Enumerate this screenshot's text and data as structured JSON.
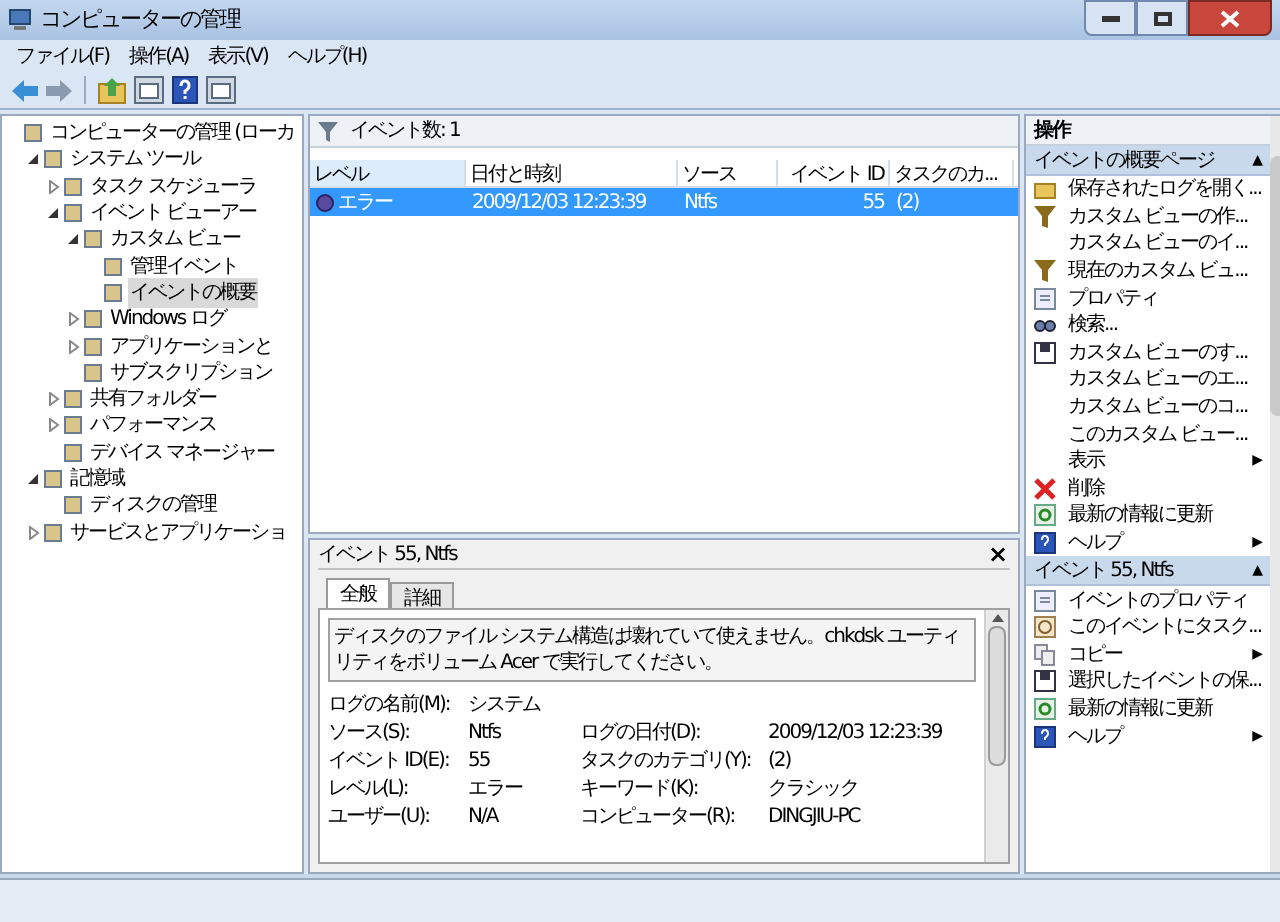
{
  "window": {
    "title": "コンピューターの管理"
  },
  "menu": [
    "ファイル(F)",
    "操作(A)",
    "表示(V)",
    "ヘルプ(H)"
  ],
  "tree": [
    {
      "label": "コンピューターの管理 (ローカ",
      "selected": false,
      "children": [
        {
          "label": "システム ツール",
          "expanded": true,
          "selected": false,
          "children": [
            {
              "label": "タスク スケジューラ",
              "expanded": false,
              "selected": false
            },
            {
              "label": "イベント ビューアー",
              "expanded": true,
              "selected": false,
              "children": [
                {
                  "label": "カスタム ビュー",
                  "expanded": true,
                  "selected": false,
                  "children": [
                    {
                      "label": "管理イベント",
                      "selected": false
                    },
                    {
                      "label": "イベントの概要",
                      "selected": true
                    }
                  ]
                },
                {
                  "label": "Windows ログ",
                  "expanded": false,
                  "selected": false
                },
                {
                  "label": "アプリケーションと",
                  "expanded": false,
                  "selected": false
                },
                {
                  "label": "サブスクリプション",
                  "selected": false
                }
              ]
            },
            {
              "label": "共有フォルダー",
              "expanded": false,
              "selected": false
            },
            {
              "label": "パフォーマンス",
              "expanded": false,
              "selected": false
            },
            {
              "label": "デバイス マネージャー",
              "selected": false
            }
          ]
        },
        {
          "label": "記憶域",
          "expanded": true,
          "selected": false,
          "children": [
            {
              "label": "ディスクの管理",
              "selected": false
            }
          ]
        },
        {
          "label": "サービスとアプリケーショ",
          "expanded": false,
          "selected": false
        }
      ]
    }
  ],
  "events": {
    "count_label": "イベント数: 1",
    "columns": [
      "レベル",
      "日付と時刻",
      "ソース",
      "イベント ID",
      "タスクのカ..."
    ],
    "rows": [
      {
        "selected": true,
        "cells": [
          "エラー",
          "2009/12/03 12:23:39",
          "Ntfs",
          "55",
          "(2)"
        ]
      }
    ]
  },
  "details": {
    "title": "イベント 55, Ntfs",
    "close": "×",
    "tabs": [
      {
        "label": "全般",
        "selected": true
      },
      {
        "label": "詳細",
        "selected": false
      }
    ],
    "message": "ディスクのファイル システム構造は壊れていて使えません。chkdsk ユーティリティをボリューム Acer で実行してください。",
    "fields": [
      [
        {
          "label": "ログの名前(M):",
          "value": "システム"
        }
      ],
      [
        {
          "label": "ソース(S):",
          "value": "Ntfs"
        },
        {
          "label": "ログの日付(D):",
          "value": "2009/12/03 12:23:39"
        }
      ],
      [
        {
          "label": "イベント ID(E):",
          "value": "55"
        },
        {
          "label": "タスクのカテゴリ(Y):",
          "value": "(2)"
        }
      ],
      [
        {
          "label": "レベル(L):",
          "value": "エラー"
        },
        {
          "label": "キーワード(K):",
          "value": "クラシック"
        }
      ],
      [
        {
          "label": "ユーザー(U):",
          "value": "N/A"
        },
        {
          "label": "コンピューター(R):",
          "value": "DINGJIU-PC"
        }
      ]
    ]
  },
  "actions": {
    "title": "操作",
    "sections": [
      {
        "title": "イベントの概要ページ",
        "collapse": "▲",
        "items": [
          {
            "kind": "open",
            "label": "保存されたログを開く..."
          },
          {
            "kind": "filter",
            "label": "カスタム ビューの作..."
          },
          {
            "kind": "none",
            "label": "カスタム ビューのイ..."
          },
          {
            "kind": "filter",
            "label": "現在のカスタム ビュ..."
          },
          {
            "kind": "properties",
            "label": "プロパティ"
          },
          {
            "kind": "find",
            "label": "検索..."
          },
          {
            "kind": "save",
            "label": "カスタム ビューのす..."
          },
          {
            "kind": "none",
            "label": "カスタム ビューのエ..."
          },
          {
            "kind": "none",
            "label": "カスタム ビューのコ..."
          },
          {
            "kind": "none",
            "label": "このカスタム ビュー..."
          },
          {
            "kind": "none",
            "label": "表示",
            "arrow": "▶"
          },
          {
            "kind": "delete",
            "label": "削除"
          },
          {
            "kind": "refresh",
            "label": "最新の情報に更新"
          },
          {
            "kind": "help",
            "label": "ヘルプ",
            "arrow": "▶"
          }
        ]
      },
      {
        "title": "イベント 55, Ntfs",
        "collapse": "▲",
        "items": [
          {
            "kind": "properties",
            "label": "イベントのプロパティ"
          },
          {
            "kind": "task",
            "label": "このイベントにタスク..."
          },
          {
            "kind": "copy",
            "label": "コピー",
            "arrow": "▶"
          },
          {
            "kind": "save",
            "label": "選択したイベントの保..."
          },
          {
            "kind": "refresh",
            "label": "最新の情報に更新"
          },
          {
            "kind": "help",
            "label": "ヘルプ",
            "arrow": "▶"
          }
        ]
      }
    ]
  }
}
